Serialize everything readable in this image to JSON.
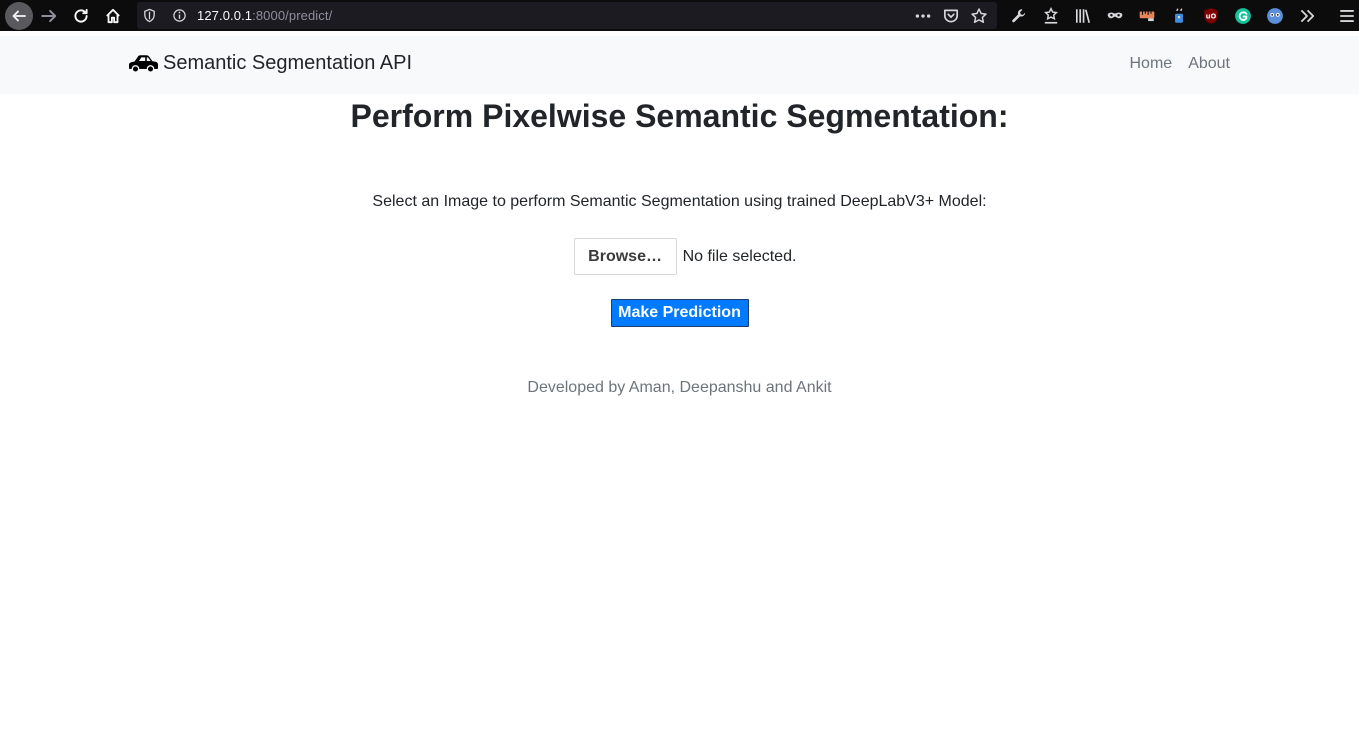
{
  "browser": {
    "url_host": "127.0.0.1",
    "url_path": ":8000/predict/",
    "colors": {
      "toolbar_bg": "#0c0c0d",
      "urlbar_bg": "#1c1b22"
    }
  },
  "navbar": {
    "brand": "Semantic Segmentation API",
    "links": [
      "Home",
      "About"
    ]
  },
  "main": {
    "title": "Perform Pixelwise Semantic Segmentation:",
    "subtitle": "Select an Image to perform Semantic Segmentation using trained DeepLabV3+ Model:",
    "browse_label": "Browse…",
    "file_status": "No file selected.",
    "predict_label": "Make Prediction",
    "footer": "Developed by Aman, Deepanshu and Ankit"
  },
  "colors": {
    "primary": "#007bff",
    "muted": "#6c757d",
    "navbar_bg": "#f8f9fa"
  }
}
